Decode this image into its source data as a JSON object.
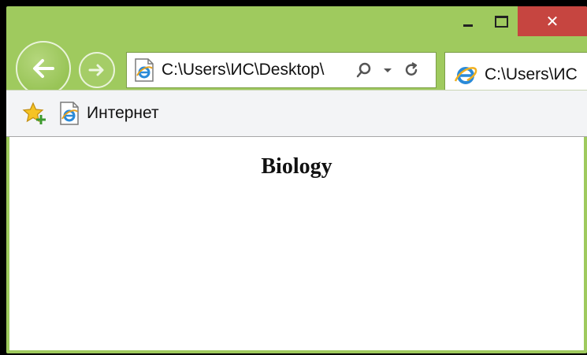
{
  "window": {
    "controls": {
      "minimize_icon": "minimize-icon",
      "maximize_icon": "maximize-icon",
      "close_glyph": "✕"
    },
    "accent_color": "#9fca5e",
    "close_color": "#c64540"
  },
  "navbar": {
    "back_icon": "back-arrow-icon",
    "forward_icon": "forward-arrow-icon",
    "address": {
      "value": "C:\\Users\\ИС\\Desktop\\",
      "page_icon": "ie-page-icon",
      "search_icon": "search-icon",
      "dropdown_icon": "dropdown-arrow-icon",
      "refresh_icon": "refresh-icon"
    },
    "tab": {
      "label": "C:\\Users\\ИС",
      "icon": "ie-logo-icon"
    }
  },
  "favorites_bar": {
    "add_favorites_icon": "add-favorites-star-icon",
    "items": [
      {
        "label": "Интернет",
        "icon": "ie-page-icon"
      }
    ]
  },
  "content": {
    "heading": "Biology"
  }
}
